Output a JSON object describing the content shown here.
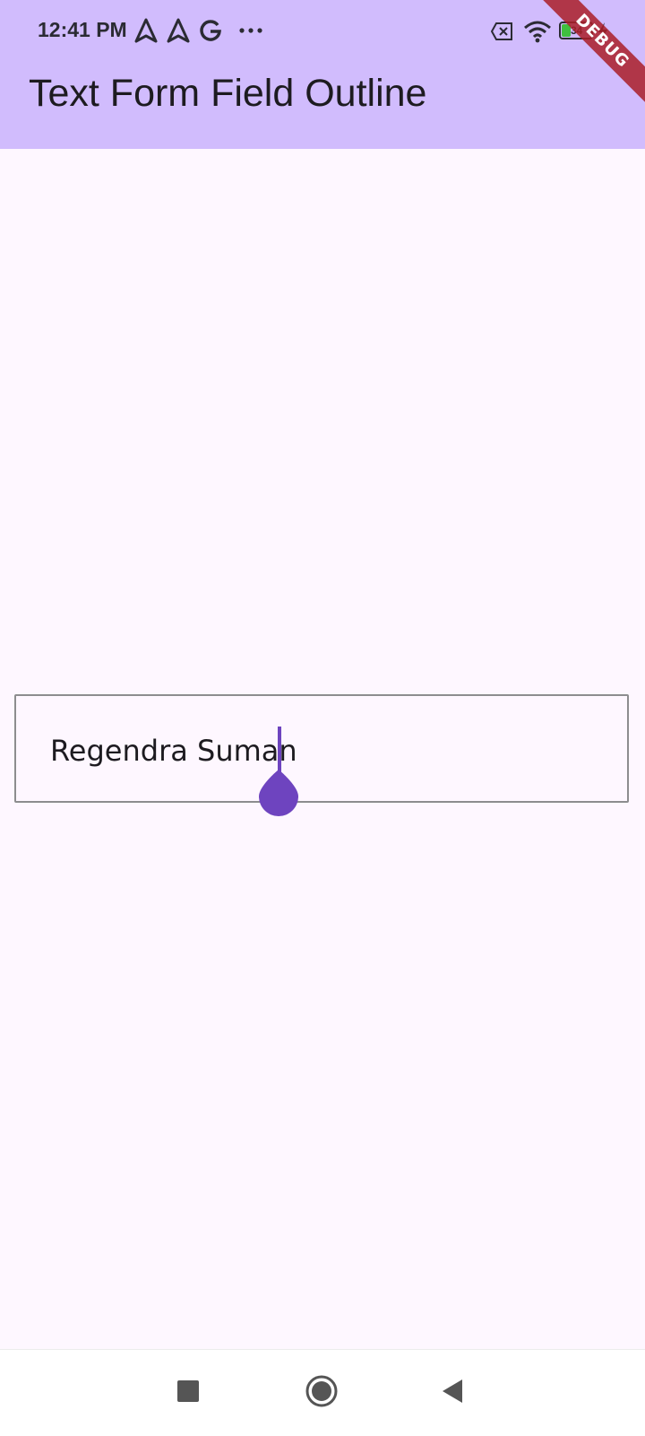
{
  "status_bar": {
    "time": "12:41 PM",
    "battery_level": "34",
    "icons": [
      "navigation-arrow-icon",
      "navigation-arrow-icon",
      "google-icon",
      "more-dots-icon",
      "no-sim-icon",
      "wifi-icon",
      "battery-icon",
      "charging-bolt-icon"
    ]
  },
  "app_bar": {
    "title": "Text Form Field Outline"
  },
  "debug_banner": {
    "label": "DEBUG"
  },
  "text_field": {
    "value": "Regendra Suman"
  },
  "navigation": {
    "icons": [
      "recents-square-icon",
      "home-circle-icon",
      "back-triangle-icon"
    ]
  },
  "colors": {
    "app_bar_bg": "#d1bcfd",
    "page_bg": "#fef7ff",
    "accent": "#6e44bf",
    "outline": "#8d8d8f",
    "debug_ribbon": "#aa1e28"
  }
}
